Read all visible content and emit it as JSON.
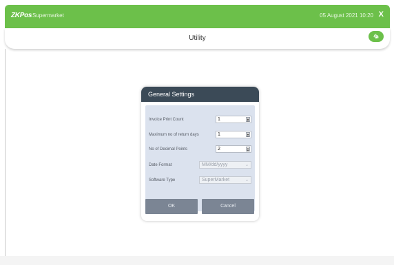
{
  "header": {
    "logo_text": "ZKPos",
    "app_name": "Supermarket",
    "datetime": "05 August 2021 10:20",
    "close_label": "X"
  },
  "titlebar": {
    "title": "Utility",
    "fingerprint_icon": "fingerprint-icon"
  },
  "dialog": {
    "title": "General Settings",
    "fields": [
      {
        "label": "Invoice Print Count",
        "value": "1",
        "type": "spinner"
      },
      {
        "label": "Maximum no of return days",
        "value": "1",
        "type": "spinner"
      },
      {
        "label": "No of Decimal Points",
        "value": "2",
        "type": "spinner"
      },
      {
        "label": "Date Format",
        "value": "MM/dd/yyyy",
        "type": "select"
      },
      {
        "label": "Software Type",
        "value": "SuperMarket",
        "type": "select"
      }
    ],
    "ok_label": "OK",
    "cancel_label": "Cancel"
  },
  "colors": {
    "accent": "#6cc04a",
    "dialog_header": "#3b4a57",
    "dialog_body": "#dbe2ee",
    "button": "#7b8594"
  }
}
